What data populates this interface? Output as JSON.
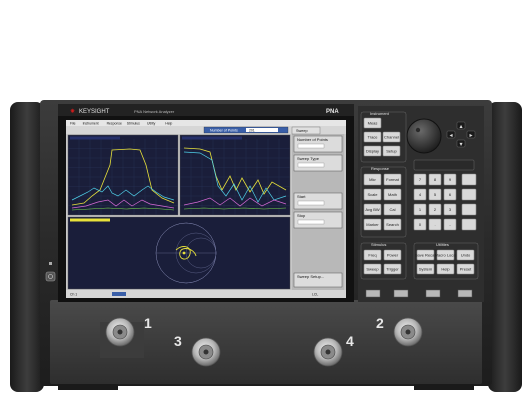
{
  "instrument": {
    "brand": "KEYSIGHT",
    "window_title": "PNA Network Analyzer",
    "model_badge": "PNA"
  },
  "screen": {
    "menu_items": [
      "File",
      "Instrument",
      "Response",
      "Stimulus",
      "Utility",
      "Help"
    ],
    "entry_label": "Number of Points",
    "entry_value": "201",
    "sweep_tab": "Sweep",
    "softkeys": [
      "Number of Points",
      "Sweep Type",
      "Start",
      "Stop",
      "Sweep Setup..."
    ],
    "status_bar_left": "Ch 1",
    "status_bar_right": "LCL"
  },
  "front_panel": {
    "groups": [
      "Instrument",
      "Response",
      "Stimulus",
      "Utilities"
    ],
    "instrument_keys": [
      "Meas",
      "Trace",
      "Display",
      "Channel",
      "Setup"
    ],
    "response_keys": [
      "Mkr",
      "Scale",
      "Avg BW",
      "Marker",
      "Format",
      "Math",
      "Cal",
      "Search"
    ],
    "stimulus_keys": [
      "Freq",
      "Power",
      "Sweep",
      "Trigger"
    ],
    "utilities_keys": [
      "Save Recall",
      "Macro Local",
      "Undo",
      "System",
      "Help",
      "Preset"
    ],
    "numeric_keys": [
      "7",
      "8",
      "9",
      "4",
      "5",
      "6",
      "1",
      "2",
      "3",
      "0",
      ".",
      "-"
    ],
    "port_numbers": [
      "1",
      "2",
      "3",
      "4"
    ]
  },
  "colors": {
    "chassis": "#2b2b2b",
    "panel": "#3a3a3a",
    "screen_bg": "#1a1e3a",
    "trace_yellow": "#e8e23a",
    "trace_cyan": "#4fd0e8",
    "trace_magenta": "#d86ad8",
    "trace_green": "#78d850",
    "brand_red": "#d01c1c",
    "preset_green": "#4caf50"
  }
}
